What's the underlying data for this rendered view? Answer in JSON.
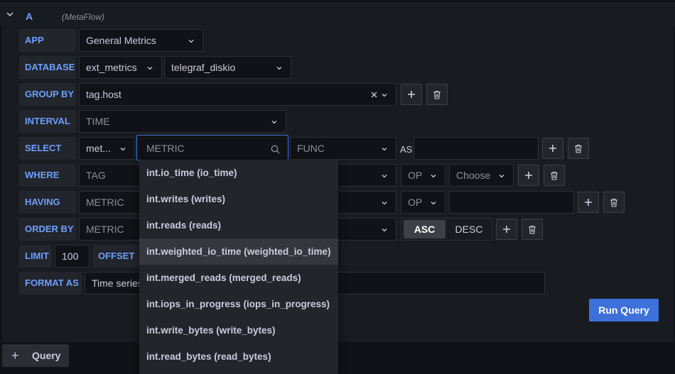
{
  "query": {
    "letter": "A",
    "datasource": "(MetaFlow)"
  },
  "rows": {
    "app": {
      "label": "APP",
      "value": "General Metrics"
    },
    "database": {
      "label": "DATABASE",
      "db": "ext_metrics",
      "table": "telegraf_diskio"
    },
    "group_by": {
      "label": "GROUP BY",
      "value": "tag.host"
    },
    "interval": {
      "label": "INTERVAL",
      "placeholder": "TIME"
    },
    "select": {
      "label": "SELECT",
      "type": "met...",
      "metric_placeholder": "METRIC",
      "func_placeholder": "FUNC",
      "as_label": "AS"
    },
    "where": {
      "label": "WHERE",
      "tag_placeholder": "TAG",
      "op_placeholder": "OP",
      "choose_placeholder": "Choose"
    },
    "having": {
      "label": "HAVING",
      "metric_placeholder": "METRIC",
      "op_placeholder": "OP"
    },
    "order_by": {
      "label": "ORDER BY",
      "metric_placeholder": "METRIC",
      "asc": "ASC",
      "desc": "DESC",
      "selected": "ASC"
    },
    "limit": {
      "label": "LIMIT",
      "value": "100",
      "offset_label": "OFFSET"
    },
    "format_as": {
      "label": "FORMAT AS",
      "value": "Time series"
    }
  },
  "dropdown": {
    "items": [
      "int.io_time (io_time)",
      "int.writes (writes)",
      "int.reads (reads)",
      "int.weighted_io_time (weighted_io_time)",
      "int.merged_reads (merged_reads)",
      "int.iops_in_progress (iops_in_progress)",
      "int.write_bytes (write_bytes)",
      "int.read_bytes (read_bytes)"
    ],
    "highlighted": "int.weighted_io_time (weighted_io_time)"
  },
  "buttons": {
    "run_query": "Run Query",
    "add_query": "Query"
  },
  "colors": {
    "accent": "#6e9fff",
    "primary": "#3d71d9",
    "background": "#111217",
    "panel": "#181b1f"
  },
  "icons": [
    "chevron-down-icon",
    "search-icon",
    "plus-icon",
    "trash-icon",
    "clear-icon"
  ]
}
